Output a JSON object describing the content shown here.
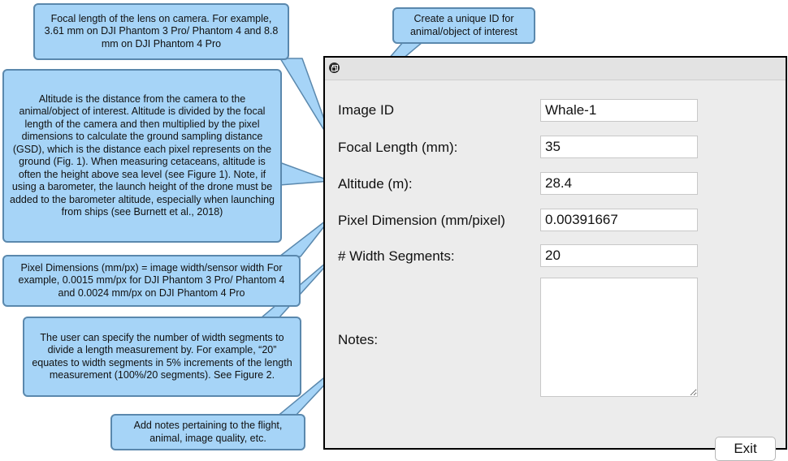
{
  "callouts": {
    "focal_length": "Focal length of the lens on camera. For example, 3.61 mm on DJI Phantom 3 Pro/ Phantom 4 and 8.8 mm on DJI Phantom 4 Pro",
    "unique_id": "Create a unique ID for animal/object of interest",
    "altitude": "Altitude is the distance from the camera to the animal/object of interest. Altitude is divided by the focal length of the camera and then multiplied by the pixel dimensions to calculate the ground sampling distance (GSD), which is the distance each pixel represents on the ground (Fig. 1). When measuring cetaceans, altitude is often the height above sea level (see Figure 1). Note, if using a barometer, the launch height of the drone must be added to the barometer altitude, especially when launching from ships (see Burnett et al., 2018)",
    "pixel_dimensions": "Pixel Dimensions (mm/px) = image width/sensor width For example, 0.0015 mm/px for DJI Phantom 3 Pro/ Phantom 4 and 0.0024 mm/px on DJI Phantom 4 Pro",
    "width_segments": "The user can specify the number of width segments to divide a length measurement by. For example, “20” equates to width segments in 5% increments of the length measurement (100%/20 segments). See Figure 2.",
    "notes": "Add notes pertaining to the flight, animal, image quality, etc."
  },
  "window": {
    "title_icon": "window-restore-icon",
    "fields": {
      "image_id": {
        "label": "Image ID",
        "value": "Whale-1"
      },
      "focal_length": {
        "label": "Focal Length (mm):",
        "value": "35"
      },
      "altitude": {
        "label": "Altitude (m):",
        "value": "28.4"
      },
      "pixel_dimension": {
        "label": "Pixel Dimension (mm/pixel)",
        "value": "0.00391667"
      },
      "width_segments": {
        "label": "# Width Segments:",
        "value": "20"
      },
      "notes": {
        "label": "Notes:",
        "value": ""
      }
    },
    "exit_label": "Exit"
  },
  "colors": {
    "callout_fill": "#a6d4f7",
    "callout_border": "#5a88ad",
    "window_background": "#ececec"
  }
}
